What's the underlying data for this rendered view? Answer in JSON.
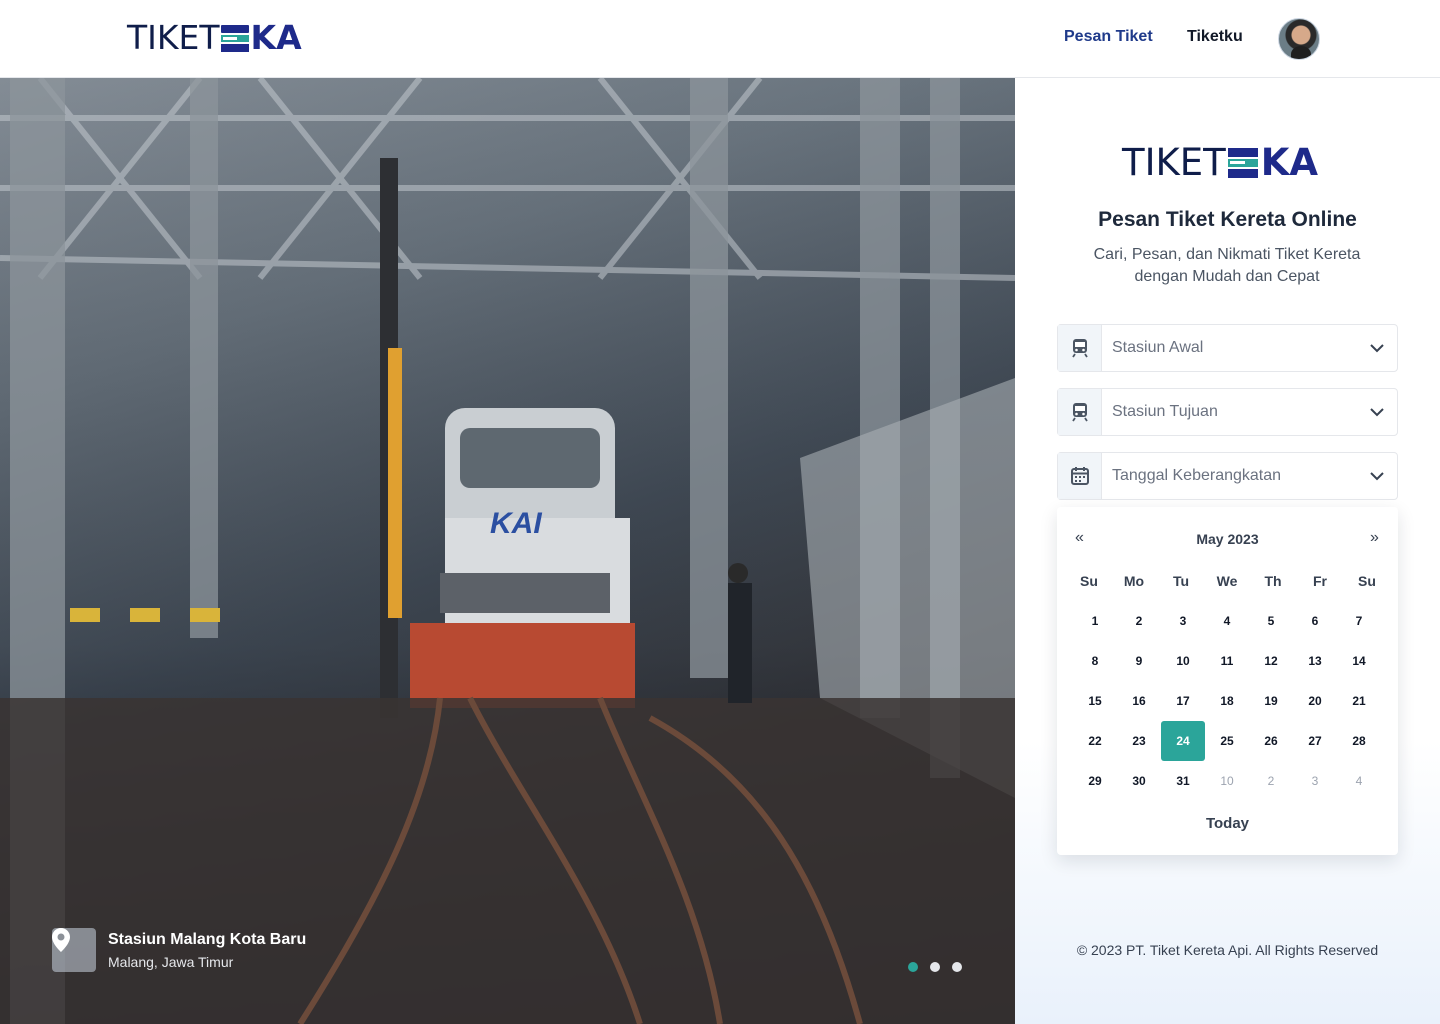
{
  "brand": {
    "text_light": "TIKET",
    "text_bold": "KA",
    "colors": {
      "navy": "#0f1d4a",
      "blue": "#1e2a8a",
      "teal": "#2ba59a"
    }
  },
  "nav": {
    "pesan_tiket": "Pesan Tiket",
    "tiketku": "Tiketku",
    "active": "Pesan Tiket"
  },
  "hero": {
    "location_title": "Stasiun Malang Kota Baru",
    "location_subtitle": "Malang, Jawa Timur",
    "loco_label": "KAI",
    "slides": {
      "count": 3,
      "active_index": 0
    }
  },
  "panel": {
    "title": "Pesan Tiket Kereta Online",
    "subtitle": "Cari, Pesan, dan Nikmati Tiket Kereta dengan Mudah dan Cepat",
    "fields": [
      {
        "placeholder": "Stasiun Awal",
        "icon": "train-icon"
      },
      {
        "placeholder": "Stasiun Tujuan",
        "icon": "train-icon"
      },
      {
        "placeholder": "Tanggal Keberangkatan",
        "icon": "calendar-icon"
      }
    ],
    "footer": "© 2023 PT. Tiket Kereta Api. All Rights Reserved"
  },
  "calendar": {
    "prev": "«",
    "next": "»",
    "month_label": "May 2023",
    "weekdays": [
      "Su",
      "Mo",
      "Tu",
      "We",
      "Th",
      "Fr",
      "Su"
    ],
    "weeks": [
      [
        "1",
        "2",
        "3",
        "4",
        "5",
        "6",
        "7"
      ],
      [
        "8",
        "9",
        "10",
        "11",
        "12",
        "13",
        "14"
      ],
      [
        "15",
        "16",
        "17",
        "18",
        "19",
        "20",
        "21"
      ],
      [
        "22",
        "23",
        "24",
        "25",
        "26",
        "27",
        "28"
      ],
      [
        "29",
        "30",
        "31",
        "10",
        "2",
        "3",
        "4"
      ]
    ],
    "muted_from": {
      "week": 4,
      "index": 3
    },
    "selected": "24",
    "today_label": "Today"
  }
}
